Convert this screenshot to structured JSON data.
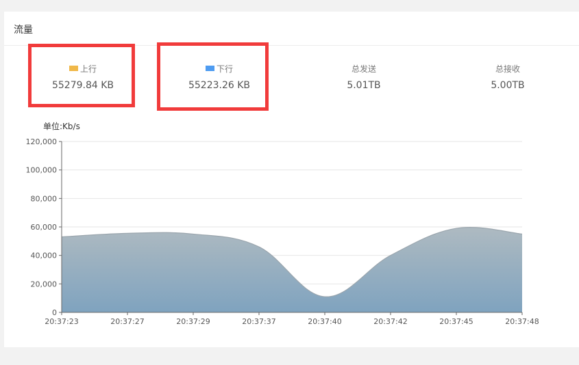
{
  "panel": {
    "title": "流量"
  },
  "stats": {
    "upstream": {
      "label": "上行",
      "value": "55279.84 KB",
      "color": "#f0b849"
    },
    "downstream": {
      "label": "下行",
      "value": "55223.26 KB",
      "color": "#4e9cf1"
    },
    "total_sent": {
      "label": "总发送",
      "value": "5.01TB"
    },
    "total_received": {
      "label": "总接收",
      "value": "5.00TB"
    }
  },
  "highlight_color": "#f13b3b",
  "chart_data": {
    "type": "area",
    "unit_label": "单位:Kb/s",
    "categories": [
      "20:37:23",
      "20:37:27",
      "20:37:29",
      "20:37:37",
      "20:37:40",
      "20:37:42",
      "20:37:45",
      "20:37:48"
    ],
    "values": [
      53000,
      55500,
      55000,
      46000,
      11000,
      40000,
      59000,
      55000
    ],
    "yticks": [
      "0",
      "20,000",
      "40,000",
      "60,000",
      "80,000",
      "100,000",
      "120,000"
    ],
    "ylim": [
      0,
      120000
    ],
    "grid": true,
    "fill_top_color": "#aebac1",
    "fill_bottom_color": "#7fa3bf",
    "line_color": "#9aa5ad"
  }
}
